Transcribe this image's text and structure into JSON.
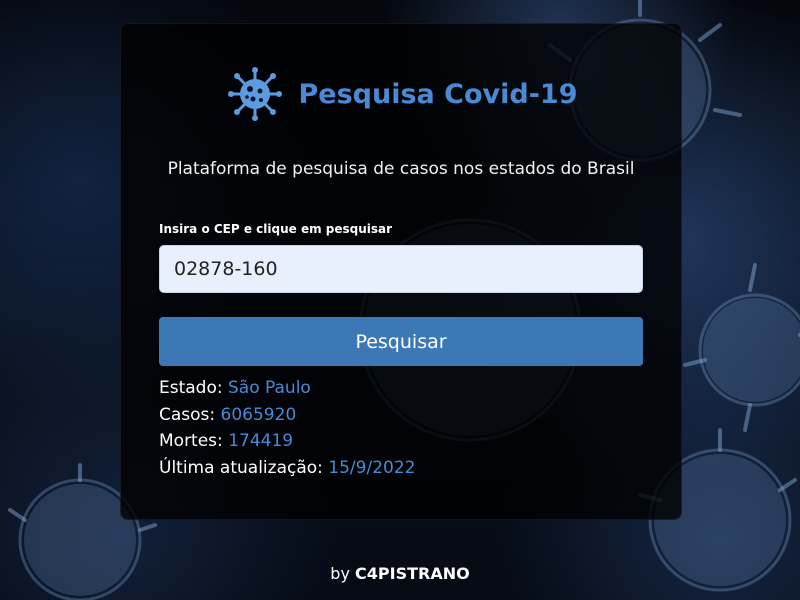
{
  "header": {
    "title": "Pesquisa Covid-19",
    "logo_icon": "virus-icon"
  },
  "subtitle": "Plataforma de pesquisa de casos nos estados do Brasil",
  "form": {
    "label": "Insira o CEP e clique em pesquisar",
    "cep_value": "02878-160",
    "search_button_label": "Pesquisar"
  },
  "results": {
    "estado_label": "Estado:",
    "estado_value": "São Paulo",
    "casos_label": "Casos:",
    "casos_value": "6065920",
    "mortes_label": "Mortes:",
    "mortes_value": "174419",
    "atualizacao_label": "Última atualização:",
    "atualizacao_value": "15/9/2022"
  },
  "footer": {
    "by_text": "by",
    "brand": "C4PISTRANO"
  },
  "colors": {
    "accent": "#4a8ad4",
    "button": "#3b78b5",
    "input_bg": "#e8f0fe"
  }
}
